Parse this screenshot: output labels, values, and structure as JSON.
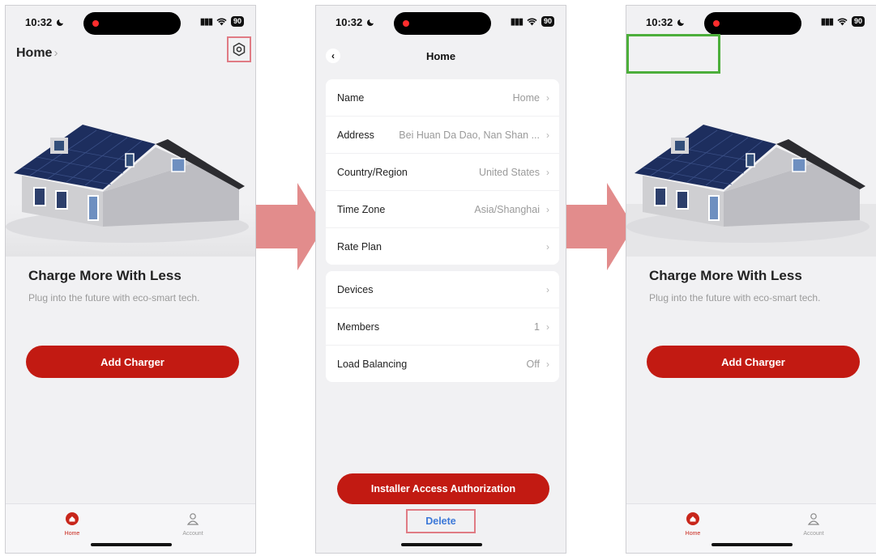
{
  "status_bar": {
    "time": "10:32",
    "battery": "90"
  },
  "home_screen": {
    "title": "Home",
    "title_chevron": "›",
    "headline": "Charge More With Less",
    "subline": "Plug into the future with eco-smart tech.",
    "add_button": "Add Charger"
  },
  "tabs": {
    "home": "Home",
    "account": "Account"
  },
  "settings_screen": {
    "back": "‹",
    "title": "Home",
    "rows_group1": [
      {
        "label": "Name",
        "value": "Home"
      },
      {
        "label": "Address",
        "value": "Bei Huan Da Dao, Nan Shan ..."
      },
      {
        "label": "Country/Region",
        "value": "United States"
      },
      {
        "label": "Time Zone",
        "value": "Asia/Shanghai"
      },
      {
        "label": "Rate Plan",
        "value": ""
      }
    ],
    "rows_group2": [
      {
        "label": "Devices",
        "value": ""
      },
      {
        "label": "Members",
        "value": "1"
      },
      {
        "label": "Load Balancing",
        "value": "Off"
      }
    ],
    "chevron": "›",
    "installer_button": "Installer Access Authorization",
    "delete_button": "Delete"
  },
  "colors": {
    "accent_red": "#c21a12",
    "highlight_pink": "#e07b84",
    "highlight_green": "#4cae3a",
    "arrow": "#e28c8c",
    "link_blue": "#3c78d8"
  },
  "icons": [
    "settings-icon",
    "home-icon",
    "account-icon",
    "chevron-right-icon",
    "back-icon",
    "house-illustration",
    "flow-arrow"
  ]
}
